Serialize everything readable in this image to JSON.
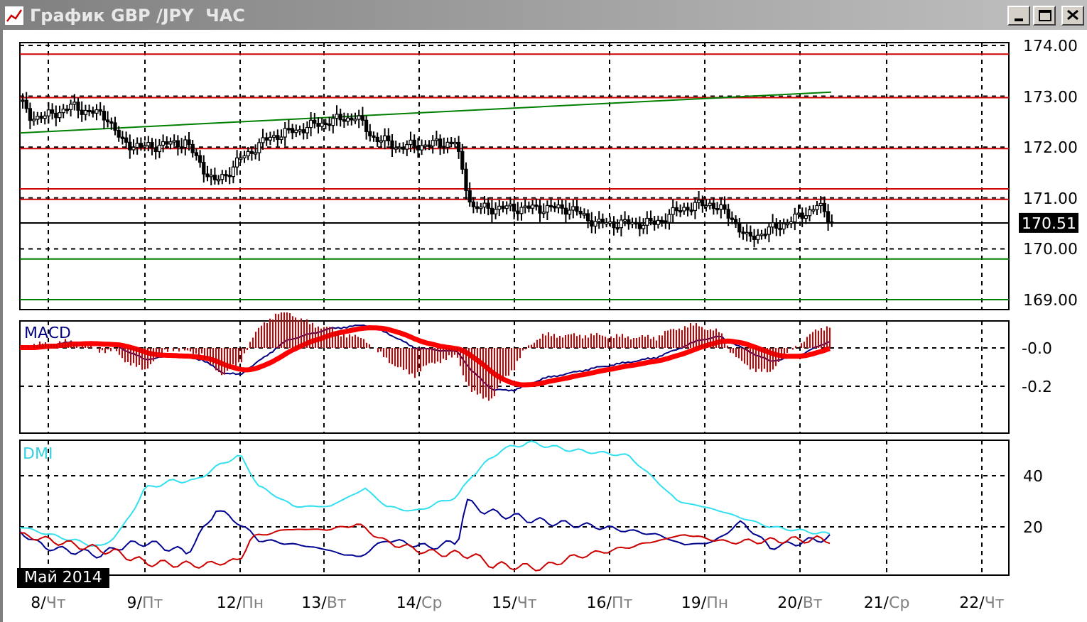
{
  "window": {
    "title": "График GBP /JPY  ЧАС"
  },
  "price_pane": {
    "ticks": [
      "174.00",
      "173.00",
      "172.00",
      "171.00",
      "170.00",
      "169.00"
    ],
    "current_price": "170.51"
  },
  "macd_pane": {
    "title": "MACD",
    "ticks": [
      "-0.0",
      "-0.2"
    ]
  },
  "dmi_pane": {
    "title": "DMI",
    "ticks": [
      "40",
      "20"
    ]
  },
  "period_label": "Май 2014",
  "date_axis": [
    {
      "day": "8/",
      "weekday": "Чт"
    },
    {
      "day": "9/",
      "weekday": "Пт"
    },
    {
      "day": "12/",
      "weekday": "Пн"
    },
    {
      "day": "13/",
      "weekday": "Вт"
    },
    {
      "day": "14/",
      "weekday": "Ср"
    },
    {
      "day": "15/",
      "weekday": "Чт"
    },
    {
      "day": "16/",
      "weekday": "Пт"
    },
    {
      "day": "19/",
      "weekday": "Пн"
    },
    {
      "day": "20/",
      "weekday": "Вт"
    },
    {
      "day": "21/",
      "weekday": "Ср"
    },
    {
      "day": "22/",
      "weekday": "Чт"
    }
  ]
}
